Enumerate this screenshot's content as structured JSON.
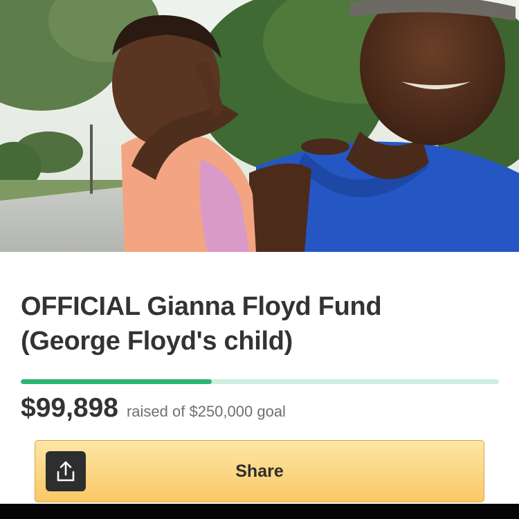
{
  "campaign": {
    "title_line1": "OFFICIAL Gianna Floyd Fund",
    "title_line2": "(George Floyd's child)",
    "raised_amount": "$99,898",
    "raised_caption": "raised of $250,000 goal",
    "progress_fraction": 0.3996
  },
  "actions": {
    "share_label": "Share",
    "share_icon": "share-upload-icon"
  },
  "colors": {
    "progress_fill": "#2bb673",
    "progress_track": "#cdeee0",
    "share_button": "#f9c866",
    "text_dark": "#333333",
    "text_muted": "#6f6f6f"
  }
}
